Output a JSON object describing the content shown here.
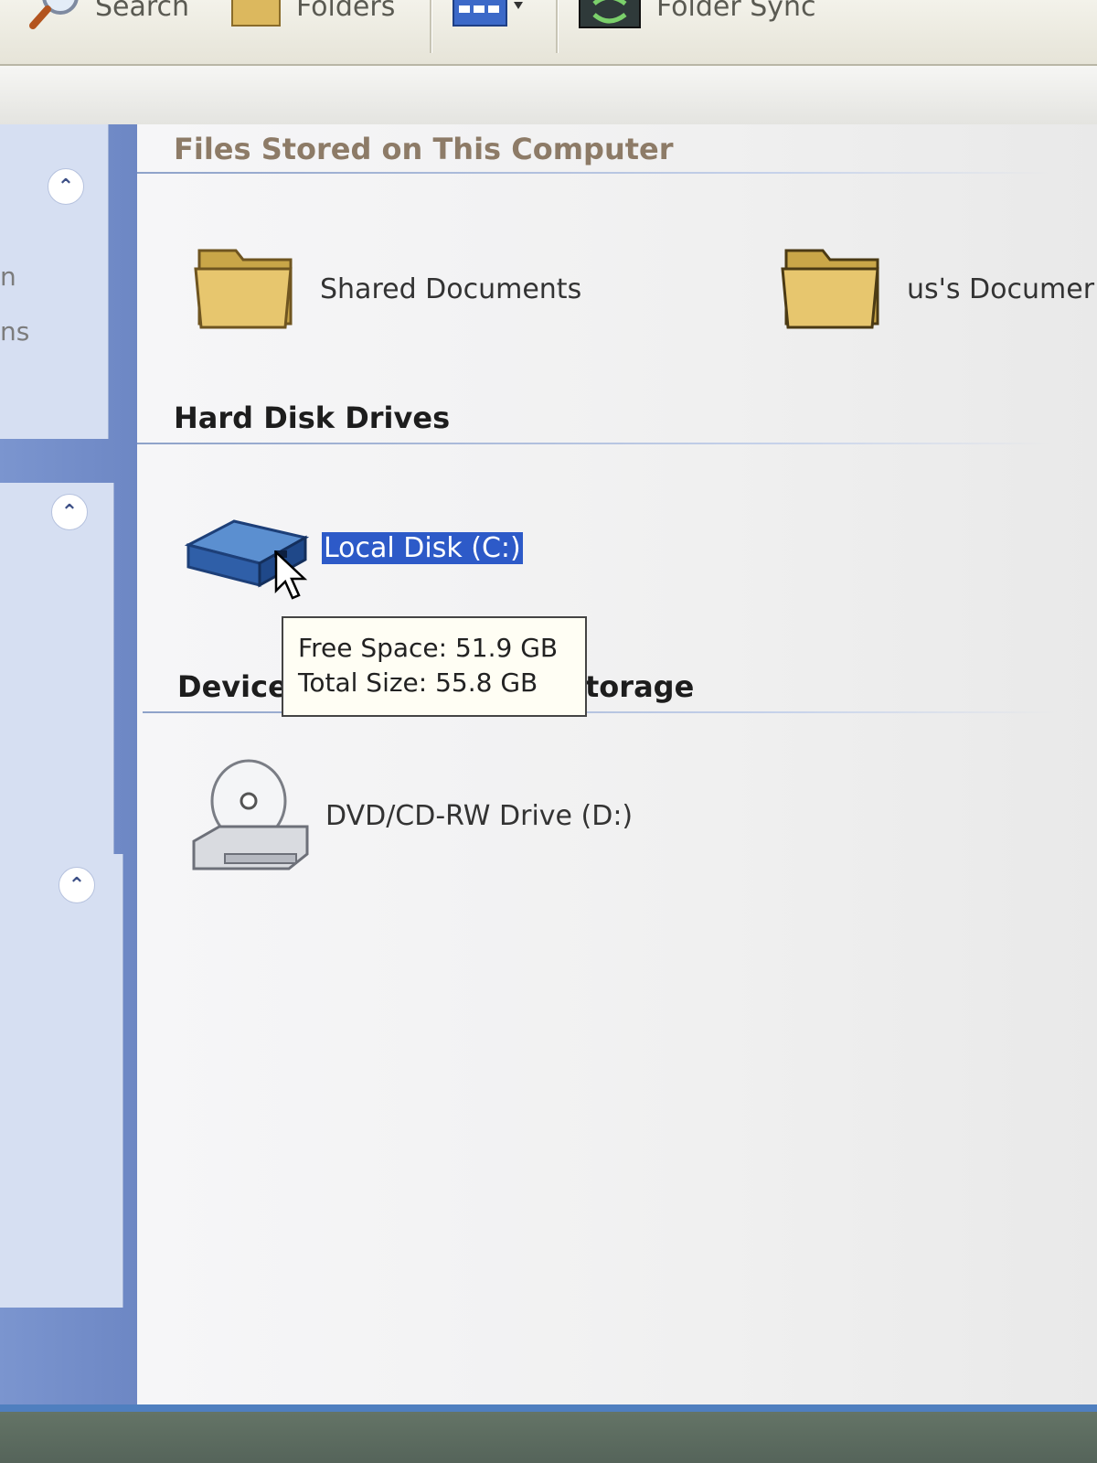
{
  "toolbar": {
    "search_label": "Search",
    "folders_label": "Folders",
    "folder_sync_label": "Folder Sync"
  },
  "leftpane": {
    "frag1": "n",
    "frag2": "ns"
  },
  "groups": {
    "files": {
      "title": "Files Stored on This Computer",
      "items": [
        "Shared Documents",
        "us's Documer"
      ]
    },
    "hdd": {
      "title": "Hard Disk Drives",
      "items": [
        "Local Disk (C:)"
      ]
    },
    "devices": {
      "title_left": "Device",
      "title_right": "torage",
      "items": [
        "DVD/CD-RW Drive (D:)"
      ]
    }
  },
  "tooltip": {
    "line1": "Free Space: 51.9 GB",
    "line2": "Total Size: 55.8 GB"
  },
  "colors": {
    "selection": "#2d5ac8",
    "taskpane": "#7b95cf",
    "folder": "#e7c66e"
  }
}
